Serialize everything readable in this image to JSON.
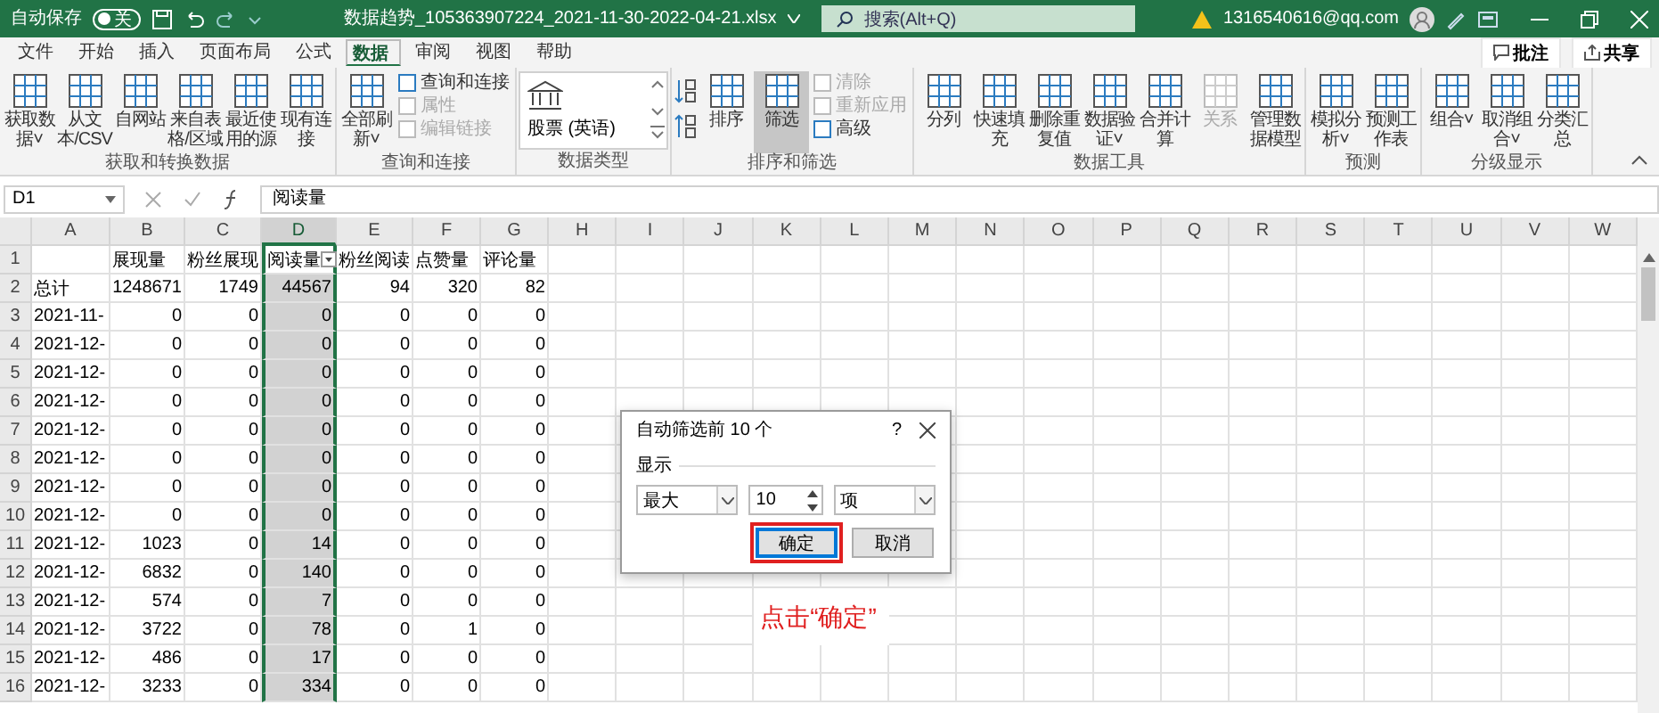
{
  "title_bar": {
    "autosave_label": "自动保存",
    "autosave_toggle": {
      "on": false,
      "label": "关"
    },
    "filename": "数据趋势_105363907224_2021-11-30-2022-04-21.xlsx",
    "search": {
      "placeholder": "搜索(Alt+Q)"
    },
    "account": "1316540616@qq.com"
  },
  "menu_tabs": [
    {
      "label": "文件",
      "selected": false
    },
    {
      "label": "开始",
      "selected": false
    },
    {
      "label": "插入",
      "selected": false
    },
    {
      "label": "页面布局",
      "selected": false
    },
    {
      "label": "公式",
      "selected": false
    },
    {
      "label": "数据",
      "selected": true
    },
    {
      "label": "审阅",
      "selected": false
    },
    {
      "label": "视图",
      "selected": false
    },
    {
      "label": "帮助",
      "selected": false
    }
  ],
  "menu_actions": [
    "批注",
    "共享"
  ],
  "ribbon_groups": [
    {
      "label": "获取和转换数据",
      "items": [
        {
          "kind": "large",
          "label": "获取数据˅",
          "disabled": false,
          "selected": false
        },
        {
          "kind": "large",
          "label": "从文本/CSV",
          "disabled": false,
          "selected": false
        },
        {
          "kind": "large",
          "label": "自网站",
          "disabled": false,
          "selected": false
        },
        {
          "kind": "large",
          "label": "来自表格/区域",
          "disabled": false,
          "selected": false
        },
        {
          "kind": "large",
          "label": "最近使用的源",
          "disabled": false,
          "selected": false
        },
        {
          "kind": "large",
          "label": "现有连接",
          "disabled": false,
          "selected": false
        }
      ]
    },
    {
      "label": "查询和连接",
      "items": [
        {
          "kind": "large",
          "label": "全部刷新˅",
          "disabled": false,
          "selected": false
        }
      ],
      "small_items": [
        {
          "label": "查询和连接",
          "disabled": false
        },
        {
          "label": "属性",
          "disabled": true
        },
        {
          "label": "编辑链接",
          "disabled": true
        }
      ]
    },
    {
      "label": "数据类型",
      "items": [
        {
          "kind": "gallery",
          "label": "股票 (英语)"
        }
      ]
    },
    {
      "label": "排序和筛选",
      "items": [
        {
          "kind": "sort"
        },
        {
          "kind": "large",
          "label": "排序",
          "disabled": false,
          "selected": false
        },
        {
          "kind": "large",
          "label": "筛选",
          "disabled": false,
          "selected": true
        }
      ],
      "small_items": [
        {
          "label": "清除",
          "disabled": true
        },
        {
          "label": "重新应用",
          "disabled": true
        },
        {
          "label": "高级",
          "disabled": false
        }
      ]
    },
    {
      "label": "数据工具",
      "items": [
        {
          "kind": "large",
          "label": "分列",
          "disabled": false,
          "selected": false
        },
        {
          "kind": "large",
          "label": "快速填充",
          "disabled": false,
          "selected": false
        },
        {
          "kind": "large",
          "label": "删除重复值",
          "disabled": false,
          "selected": false
        },
        {
          "kind": "large",
          "label": "数据验证˅",
          "disabled": false,
          "selected": false
        },
        {
          "kind": "large",
          "label": "合并计算",
          "disabled": false,
          "selected": false
        },
        {
          "kind": "large",
          "label": "关系",
          "disabled": true,
          "selected": false
        },
        {
          "kind": "large",
          "label": "管理数据模型",
          "disabled": false,
          "selected": false
        }
      ]
    },
    {
      "label": "预测",
      "items": [
        {
          "kind": "large",
          "label": "模拟分析˅",
          "disabled": false,
          "selected": false
        },
        {
          "kind": "large",
          "label": "预测工作表",
          "disabled": false,
          "selected": false
        }
      ]
    },
    {
      "label": "分级显示",
      "items": [
        {
          "kind": "large",
          "label": "组合˅",
          "disabled": false,
          "selected": false
        },
        {
          "kind": "large",
          "label": "取消组合˅",
          "disabled": false,
          "selected": false
        },
        {
          "kind": "large",
          "label": "分类汇总",
          "disabled": false,
          "selected": false
        }
      ]
    }
  ],
  "formula_bar": {
    "name_box": "D1",
    "content": "阅读量"
  },
  "sheet": {
    "columns": [
      {
        "letter": "A",
        "selected": false,
        "filtered": false
      },
      {
        "letter": "B",
        "selected": false,
        "filtered": false
      },
      {
        "letter": "C",
        "selected": false,
        "filtered": false
      },
      {
        "letter": "D",
        "selected": true,
        "filtered": true
      },
      {
        "letter": "E",
        "selected": false,
        "filtered": false
      },
      {
        "letter": "F",
        "selected": false,
        "filtered": false
      },
      {
        "letter": "G",
        "selected": false,
        "filtered": false
      },
      {
        "letter": "H",
        "selected": false,
        "filtered": false
      },
      {
        "letter": "I",
        "selected": false,
        "filtered": false
      },
      {
        "letter": "J",
        "selected": false,
        "filtered": false
      },
      {
        "letter": "K",
        "selected": false,
        "filtered": false
      },
      {
        "letter": "L",
        "selected": false,
        "filtered": false
      },
      {
        "letter": "M",
        "selected": false,
        "filtered": false
      },
      {
        "letter": "N",
        "selected": false,
        "filtered": false
      },
      {
        "letter": "O",
        "selected": false,
        "filtered": false
      },
      {
        "letter": "P",
        "selected": false,
        "filtered": false
      },
      {
        "letter": "Q",
        "selected": false,
        "filtered": false
      },
      {
        "letter": "R",
        "selected": false,
        "filtered": false
      },
      {
        "letter": "S",
        "selected": false,
        "filtered": false
      },
      {
        "letter": "T",
        "selected": false,
        "filtered": false
      },
      {
        "letter": "U",
        "selected": false,
        "filtered": false
      },
      {
        "letter": "V",
        "selected": false,
        "filtered": false
      },
      {
        "letter": "W",
        "selected": false,
        "filtered": false
      }
    ],
    "rows": [
      {
        "number": "1",
        "cells": [
          "",
          "展现量",
          "粉丝展现",
          "阅读量",
          "粉丝阅读",
          "点赞量",
          "评论量"
        ]
      },
      {
        "number": "2",
        "cells": [
          "总计",
          "1248671",
          "1749",
          "44567",
          "94",
          "320",
          "82"
        ]
      },
      {
        "number": "3",
        "cells": [
          "2021-11-",
          "0",
          "0",
          "0",
          "0",
          "0",
          "0"
        ]
      },
      {
        "number": "4",
        "cells": [
          "2021-12-",
          "0",
          "0",
          "0",
          "0",
          "0",
          "0"
        ]
      },
      {
        "number": "5",
        "cells": [
          "2021-12-",
          "0",
          "0",
          "0",
          "0",
          "0",
          "0"
        ]
      },
      {
        "number": "6",
        "cells": [
          "2021-12-",
          "0",
          "0",
          "0",
          "0",
          "0",
          "0"
        ]
      },
      {
        "number": "7",
        "cells": [
          "2021-12-",
          "0",
          "0",
          "0",
          "0",
          "0",
          "0"
        ]
      },
      {
        "number": "8",
        "cells": [
          "2021-12-",
          "0",
          "0",
          "0",
          "0",
          "0",
          "0"
        ]
      },
      {
        "number": "9",
        "cells": [
          "2021-12-",
          "0",
          "0",
          "0",
          "0",
          "0",
          "0"
        ]
      },
      {
        "number": "10",
        "cells": [
          "2021-12-",
          "0",
          "0",
          "0",
          "0",
          "0",
          "0"
        ]
      },
      {
        "number": "11",
        "cells": [
          "2021-12-",
          "1023",
          "0",
          "14",
          "0",
          "0",
          "0"
        ]
      },
      {
        "number": "12",
        "cells": [
          "2021-12-",
          "6832",
          "0",
          "140",
          "0",
          "0",
          "0"
        ]
      },
      {
        "number": "13",
        "cells": [
          "2021-12-",
          "574",
          "0",
          "7",
          "0",
          "0",
          "0"
        ]
      },
      {
        "number": "14",
        "cells": [
          "2021-12-",
          "3722",
          "0",
          "78",
          "0",
          "1",
          "0"
        ]
      },
      {
        "number": "15",
        "cells": [
          "2021-12-",
          "486",
          "0",
          "17",
          "0",
          "0",
          "0"
        ]
      },
      {
        "number": "16",
        "cells": [
          "2021-12-",
          "3233",
          "0",
          "334",
          "0",
          "0",
          "0"
        ]
      }
    ]
  },
  "dialog": {
    "title": "自动筛选前 10 个",
    "help": "?",
    "section": "显示",
    "order": "最大",
    "count": "10",
    "unit": "项",
    "buttons": [
      {
        "label": "确定",
        "focused": true,
        "highlighted": true
      },
      {
        "label": "取消",
        "focused": false,
        "highlighted": false
      }
    ]
  },
  "annotation": "点击“确定”"
}
